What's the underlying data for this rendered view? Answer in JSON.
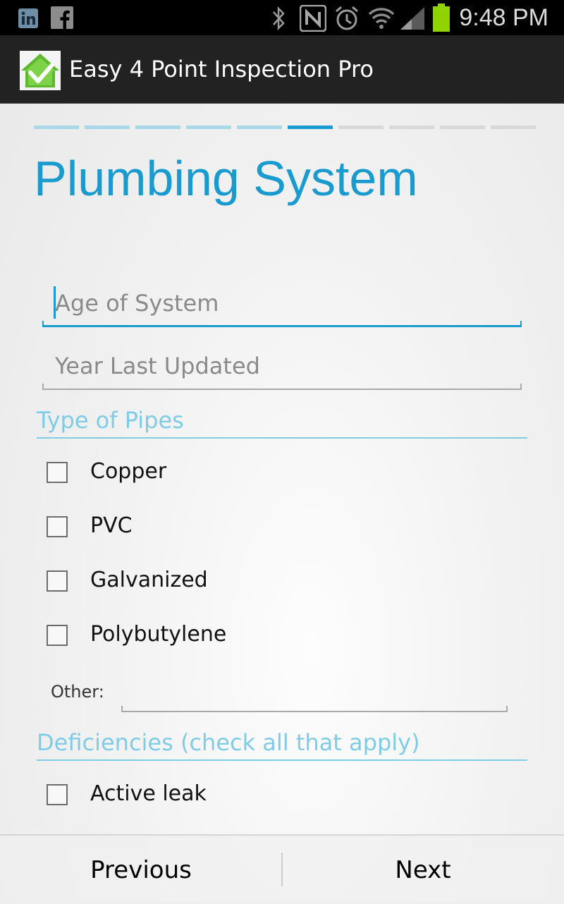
{
  "status_bar": {
    "time": "9:48 PM",
    "icons": [
      "linkedin-icon",
      "facebook-icon",
      "bluetooth-icon",
      "nfc-icon",
      "alarm-icon",
      "wifi-icon",
      "signal-icon",
      "battery-icon"
    ],
    "battery_color": "#8fd400"
  },
  "action_bar": {
    "app_title": "Easy 4 Point Inspection Pro",
    "app_icon": "house-checkmark-icon"
  },
  "progress": {
    "total_steps": 10,
    "current_step": 6,
    "colors": {
      "completed": "#a9d8e6",
      "current": "#1a9bd0",
      "upcoming": "#d8d8d8"
    }
  },
  "page": {
    "title": "Plumbing System",
    "accent": "#1a9bd0"
  },
  "form": {
    "age_of_system": {
      "placeholder": "Age of System",
      "value": ""
    },
    "year_last_updated": {
      "placeholder": "Year Last Updated",
      "value": ""
    },
    "type_of_pipes": {
      "heading": "Type of Pipes",
      "options": [
        {
          "label": "Copper",
          "checked": false
        },
        {
          "label": "PVC",
          "checked": false
        },
        {
          "label": "Galvanized",
          "checked": false
        },
        {
          "label": "Polybutylene",
          "checked": false
        }
      ],
      "other_label": "Other:",
      "other_value": ""
    },
    "deficiencies": {
      "heading": "Deficiencies (check all that apply)",
      "options": [
        {
          "label": "Active leak",
          "checked": false
        }
      ]
    }
  },
  "bottom_bar": {
    "previous_label": "Previous",
    "next_label": "Next"
  }
}
